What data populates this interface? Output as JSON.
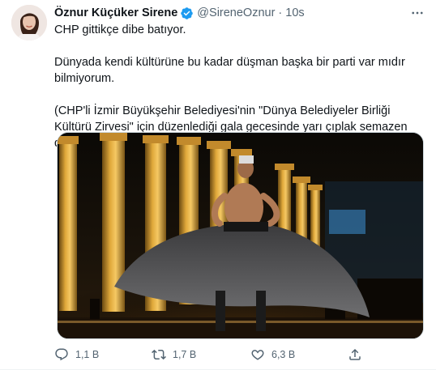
{
  "tweet": {
    "author_name": "Öznur Küçüker Sirene",
    "handle": "@SireneOznur",
    "separator": "·",
    "time": "10s",
    "line1": "CHP gittikçe dibe batıyor.",
    "line2": "Dünyada kendi kültürüne bu kadar düşman başka bir parti var mıdır bilmiyorum.",
    "line3": "(CHP'li İzmir Büyükşehir Belediyesi'nin \"Dünya Belediyeler Birliği Kültürü Zirvesi\" için düzenlediği gala gecesinde yarı çıplak semazen dans etti)",
    "line3_emoji": "👇",
    "media_alt": "Semazen dancing in front of illuminated ancient columns at night"
  },
  "actions": {
    "reply_count": "1,1 B",
    "retweet_count": "1,7 B",
    "like_count": "6,3 B"
  },
  "icons": {
    "verified": "verified-badge-icon",
    "more": "more-horizontal-icon",
    "reply": "reply-icon",
    "retweet": "retweet-icon",
    "like": "heart-icon",
    "share": "share-icon"
  },
  "colors": {
    "verified": "#1d9bf0",
    "secondary_text": "#536471",
    "primary_text": "#0f1419"
  }
}
